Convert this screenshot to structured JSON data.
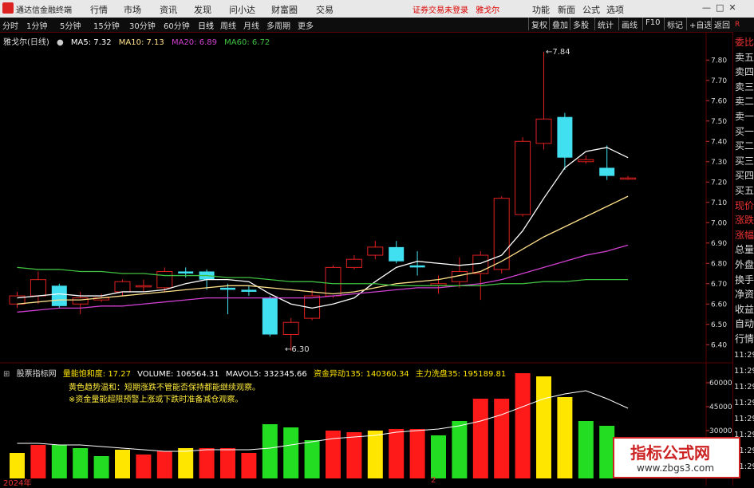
{
  "menubar": {
    "app_title": "通达信金融终端",
    "items": [
      "行情",
      "市场",
      "资讯",
      "发现",
      "问小达",
      "财富圈",
      "交易"
    ],
    "trade_status": "证券交易未登录",
    "stock_short": "雅戈尔",
    "right_items": [
      "功能",
      "新面",
      "公式",
      "选项"
    ],
    "window_buttons": "—□✕"
  },
  "toolbar": {
    "periods": [
      "分时",
      "1分钟",
      "5分钟",
      "15分钟",
      "30分钟",
      "60分钟",
      "日线",
      "周线",
      "月线",
      "多周期",
      "更多"
    ],
    "active_period": "日线",
    "right_buttons": [
      "复权",
      "叠加",
      "多股",
      "统计",
      "画线",
      "F10",
      "标记",
      "+自选",
      "返回"
    ]
  },
  "ma_line": {
    "name": "雅戈尔(日线)",
    "ma5": "MA5: 7.32",
    "ma10": "MA10: 7.13",
    "ma20": "MA20: 6.89",
    "ma60": "MA60: 6.72"
  },
  "colors": {
    "up": "#e02020",
    "down": "#40e0f0",
    "ma5": "#ffffff",
    "ma10": "#ffe08a",
    "ma20": "#d040d0",
    "ma60": "#40c040",
    "vol_yellow": "#ffe600",
    "vol_red": "#ff1a1a",
    "vol_green": "#22dd22"
  },
  "sidebar": {
    "items": [
      "委比",
      "卖五",
      "卖四",
      "卖三",
      "卖二",
      "卖一",
      "买一",
      "买二",
      "买三",
      "买四",
      "买五",
      "现价",
      "涨跌",
      "涨幅",
      "总量",
      "外盘",
      "换手",
      "净资",
      "收益",
      "自动",
      "行情"
    ],
    "times": [
      "11:29",
      "11:29",
      "11:29",
      "11:29",
      "11:29",
      "11:29",
      "11:29",
      "11:29"
    ],
    "top_mark": "R"
  },
  "indicator": {
    "title": "股票指标网",
    "fields": [
      "量能饱和度: 17.27",
      "VOLUME: 106564.31",
      "MAVOL5: 332345.66",
      "资金异动135: 140360.34",
      "主力洗盘35: 195189.81"
    ],
    "note1": "黄色趋势温和：短期涨跌不管能否保持都能继续观察。",
    "note2": "※资金量能超限预警上涨或下跌时准备减仓观察。"
  },
  "annotations": {
    "high": "7.84",
    "low": "6.30"
  },
  "date_label": "2024年",
  "date_mark": "2",
  "watermark": {
    "title": "指标公式网",
    "url": "www.zbgs3.com"
  },
  "chart_data": {
    "type": "candlestick",
    "price_axis": {
      "ylim": [
        6.35,
        7.86
      ],
      "ticks": [
        7.8,
        7.7,
        7.6,
        7.5,
        7.4,
        7.3,
        7.2,
        7.1,
        7.0,
        6.9,
        6.8,
        6.7,
        6.6,
        6.5,
        6.4
      ]
    },
    "candles": [
      {
        "o": 6.6,
        "c": 6.64,
        "h": 6.66,
        "l": 6.58
      },
      {
        "o": 6.64,
        "c": 6.72,
        "h": 6.76,
        "l": 6.6
      },
      {
        "o": 6.69,
        "c": 6.59,
        "h": 6.7,
        "l": 6.58
      },
      {
        "o": 6.6,
        "c": 6.63,
        "h": 6.66,
        "l": 6.55
      },
      {
        "o": 6.62,
        "c": 6.63,
        "h": 6.65,
        "l": 6.61
      },
      {
        "o": 6.66,
        "c": 6.71,
        "h": 6.72,
        "l": 6.64
      },
      {
        "o": 6.69,
        "c": 6.69,
        "h": 6.72,
        "l": 6.66
      },
      {
        "o": 6.68,
        "c": 6.76,
        "h": 6.78,
        "l": 6.66
      },
      {
        "o": 6.76,
        "c": 6.75,
        "h": 6.78,
        "l": 6.73
      },
      {
        "o": 6.76,
        "c": 6.72,
        "h": 6.77,
        "l": 6.67
      },
      {
        "o": 6.68,
        "c": 6.67,
        "h": 6.7,
        "l": 6.55
      },
      {
        "o": 6.67,
        "c": 6.66,
        "h": 6.69,
        "l": 6.64
      },
      {
        "o": 6.63,
        "c": 6.45,
        "h": 6.64,
        "l": 6.44
      },
      {
        "o": 6.45,
        "c": 6.51,
        "h": 6.53,
        "l": 6.37
      },
      {
        "o": 6.53,
        "c": 6.64,
        "h": 6.67,
        "l": 6.52
      },
      {
        "o": 6.64,
        "c": 6.78,
        "h": 6.79,
        "l": 6.63
      },
      {
        "o": 6.78,
        "c": 6.82,
        "h": 6.84,
        "l": 6.77
      },
      {
        "o": 6.84,
        "c": 6.88,
        "h": 6.91,
        "l": 6.82
      },
      {
        "o": 6.88,
        "c": 6.81,
        "h": 6.91,
        "l": 6.8
      },
      {
        "o": 6.79,
        "c": 6.78,
        "h": 6.86,
        "l": 6.74
      },
      {
        "o": 6.69,
        "c": 6.7,
        "h": 6.74,
        "l": 6.65
      },
      {
        "o": 6.71,
        "c": 6.76,
        "h": 6.83,
        "l": 6.68
      },
      {
        "o": 6.75,
        "c": 6.84,
        "h": 6.86,
        "l": 6.62
      },
      {
        "o": 6.77,
        "c": 7.12,
        "h": 7.13,
        "l": 6.75
      },
      {
        "o": 7.04,
        "c": 7.4,
        "h": 7.42,
        "l": 7.03
      },
      {
        "o": 7.39,
        "c": 7.51,
        "h": 7.84,
        "l": 7.36
      },
      {
        "o": 7.52,
        "c": 7.32,
        "h": 7.54,
        "l": 7.26
      },
      {
        "o": 7.3,
        "c": 7.31,
        "h": 7.33,
        "l": 7.29
      },
      {
        "o": 7.27,
        "c": 7.23,
        "h": 7.38,
        "l": 7.21
      },
      {
        "o": 7.22,
        "c": 7.22,
        "h": 7.23,
        "l": 7.21
      }
    ],
    "ma": {
      "MA5": [
        6.63,
        6.64,
        6.65,
        6.64,
        6.64,
        6.66,
        6.66,
        6.67,
        6.7,
        6.72,
        6.72,
        6.71,
        6.65,
        6.6,
        6.58,
        6.6,
        6.63,
        6.71,
        6.78,
        6.81,
        6.8,
        6.79,
        6.8,
        6.84,
        6.96,
        7.12,
        7.27,
        7.35,
        7.37,
        7.32
      ],
      "MA10": [
        6.6,
        6.61,
        6.62,
        6.62,
        6.63,
        6.64,
        6.65,
        6.66,
        6.67,
        6.68,
        6.69,
        6.69,
        6.68,
        6.67,
        6.66,
        6.65,
        6.66,
        6.68,
        6.7,
        6.71,
        6.72,
        6.74,
        6.76,
        6.81,
        6.87,
        6.93,
        6.98,
        7.03,
        7.08,
        7.13
      ],
      "MA20": [
        6.56,
        6.57,
        6.58,
        6.58,
        6.59,
        6.59,
        6.6,
        6.61,
        6.62,
        6.63,
        6.63,
        6.63,
        6.63,
        6.63,
        6.63,
        6.64,
        6.65,
        6.66,
        6.67,
        6.68,
        6.68,
        6.69,
        6.7,
        6.72,
        6.75,
        6.78,
        6.81,
        6.84,
        6.86,
        6.89
      ],
      "MA60": [
        6.78,
        6.77,
        6.77,
        6.76,
        6.76,
        6.75,
        6.75,
        6.74,
        6.74,
        6.74,
        6.73,
        6.73,
        6.72,
        6.71,
        6.71,
        6.7,
        6.7,
        6.7,
        6.69,
        6.69,
        6.69,
        6.69,
        6.69,
        6.7,
        6.7,
        6.71,
        6.71,
        6.72,
        6.72,
        6.72
      ]
    },
    "volume_axis": {
      "ylim": [
        0,
        66000
      ],
      "ticks": [
        60000,
        45000,
        30000
      ]
    },
    "volume": [
      {
        "v": 16000,
        "c": "yellow"
      },
      {
        "v": 21000,
        "c": "red"
      },
      {
        "v": 21000,
        "c": "green"
      },
      {
        "v": 19000,
        "c": "green"
      },
      {
        "v": 14000,
        "c": "green"
      },
      {
        "v": 18000,
        "c": "yellow"
      },
      {
        "v": 15000,
        "c": "red"
      },
      {
        "v": 17000,
        "c": "red"
      },
      {
        "v": 19000,
        "c": "yellow"
      },
      {
        "v": 19000,
        "c": "red"
      },
      {
        "v": 19000,
        "c": "red"
      },
      {
        "v": 16000,
        "c": "red"
      },
      {
        "v": 34000,
        "c": "green"
      },
      {
        "v": 32000,
        "c": "green"
      },
      {
        "v": 24000,
        "c": "green"
      },
      {
        "v": 30000,
        "c": "red"
      },
      {
        "v": 29000,
        "c": "red"
      },
      {
        "v": 30000,
        "c": "yellow"
      },
      {
        "v": 31000,
        "c": "red"
      },
      {
        "v": 31000,
        "c": "red"
      },
      {
        "v": 27000,
        "c": "green"
      },
      {
        "v": 36000,
        "c": "green"
      },
      {
        "v": 50000,
        "c": "red"
      },
      {
        "v": 50000,
        "c": "red"
      },
      {
        "v": 66000,
        "c": "red"
      },
      {
        "v": 64000,
        "c": "yellow"
      },
      {
        "v": 51000,
        "c": "yellow"
      },
      {
        "v": 36000,
        "c": "green"
      },
      {
        "v": 33000,
        "c": "green"
      },
      {
        "v": 20000,
        "c": "yellow"
      }
    ],
    "mavol": [
      22000,
      22000,
      21000,
      21000,
      20000,
      19000,
      18000,
      17000,
      17000,
      18000,
      18000,
      18000,
      19000,
      21000,
      23000,
      25000,
      26000,
      27000,
      29000,
      30000,
      31000,
      33000,
      36000,
      40000,
      45000,
      50000,
      53000,
      55000,
      50000,
      44000
    ]
  }
}
